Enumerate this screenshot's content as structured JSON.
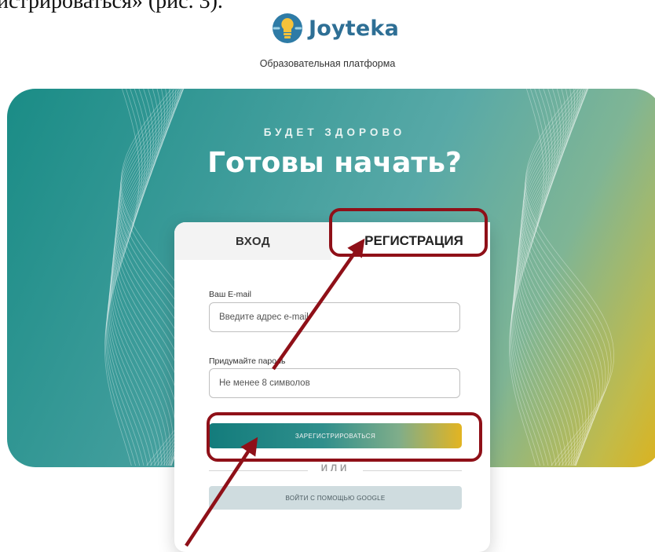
{
  "document": {
    "caption_fragment": "истрироваться» (рис. 3)."
  },
  "header": {
    "logo_text": "Joyteka",
    "tagline": "Образовательная платформа"
  },
  "hero": {
    "overline": "БУДЕТ ЗДОРОВО",
    "headline": "Готовы начать?"
  },
  "auth_card": {
    "tabs": [
      {
        "label": "ВХОД",
        "active": false
      },
      {
        "label": "РЕГИСТРАЦИЯ",
        "active": true
      }
    ],
    "email": {
      "label": "Ваш E-mail",
      "placeholder": "Введите адрес e-mail"
    },
    "password": {
      "label": "Придумайте пароль",
      "placeholder": "Не менее 8 символов"
    },
    "register_button": "ЗАРЕГИСТРИРОВАТЬСЯ",
    "or_divider": "ИЛИ",
    "google_button": "ВОЙТИ С ПОМОЩЬЮ GOOGLE"
  },
  "colors": {
    "brand": "#2e6f95",
    "teal": "#1a8c86",
    "gold": "#ddb21c",
    "annotation": "#8f1018"
  },
  "icons": [
    "lightbulb-logo-icon",
    "arrow-annotation"
  ]
}
